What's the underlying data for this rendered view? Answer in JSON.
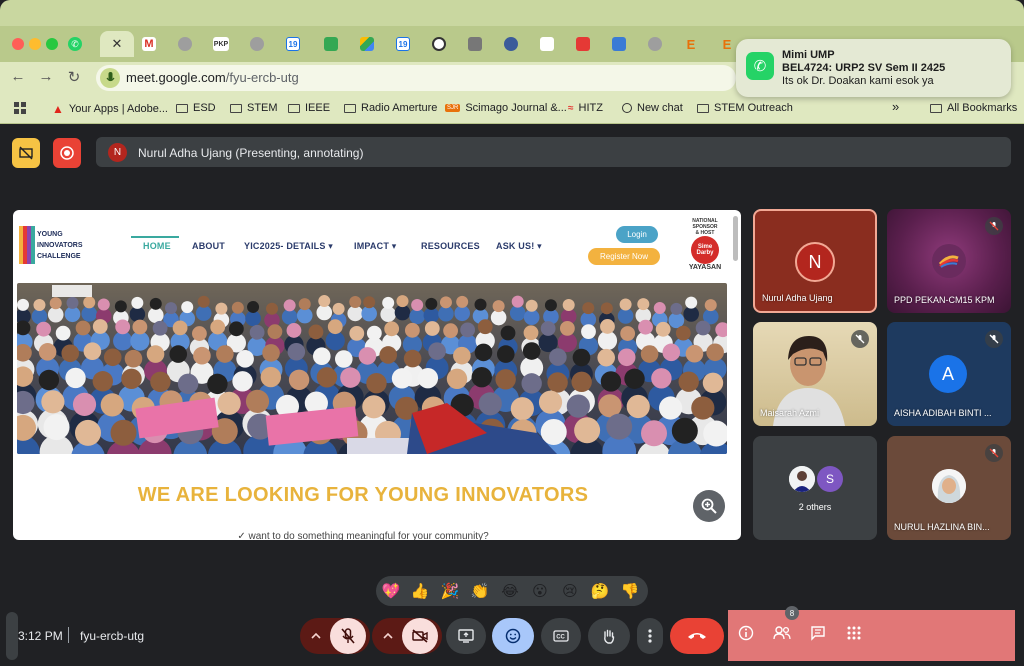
{
  "browser": {
    "url_host": "meet.google.com",
    "url_path": "/fyu-ercb-utg",
    "bookmarks": [
      "Your Apps | Adobe...",
      "ESD",
      "STEM",
      "IEEE",
      "Radio Amerture",
      "Scimago Journal &...",
      "HITZ",
      "New chat",
      "STEM Outreach"
    ],
    "bookmarks_overflow": "»",
    "all_bookmarks": "All Bookmarks",
    "scimago_badge": "SJR",
    "tab_pkp": "PKP",
    "tab_cal_a": "19",
    "tab_cal_b": "19",
    "tab_e_a": "E",
    "tab_e_b": "E"
  },
  "notification": {
    "sender": "Mimi UMP",
    "title": "BEL4724: URP2 SV Sem II 2425",
    "message": "Its ok Dr. Doakan kami esok ya"
  },
  "meet": {
    "presenting_initial": "N",
    "presenting_label": "Nurul Adha Ujang (Presenting, annotating)",
    "time": "3:12 PM",
    "meeting_code": "fyu-ercb-utg",
    "participant_count": "8"
  },
  "shared_page": {
    "logo_lines": [
      "YOUNG",
      "INNOVATORS",
      "CHALLENGE"
    ],
    "nav": [
      "HOME",
      "ABOUT",
      "YIC2025- DETAILS",
      "IMPACT",
      "RESOURCES",
      "ASK US!"
    ],
    "login": "Login",
    "register": "Register Now",
    "sponsor_lines": [
      "NATIONAL",
      "SPONSOR",
      "& HOST"
    ],
    "sponsor_logo": "Sime Darby",
    "sponsor_name": "YAYASAN",
    "headline": "WE ARE LOOKING FOR YOUNG INNOVATORS",
    "subline": "✓ want to do something meaningful for your community?"
  },
  "tiles": [
    {
      "name": "Nurul Adha Ujang",
      "initial": "N"
    },
    {
      "name": "PPD PEKAN-CM15 KPM"
    },
    {
      "name": "Maisarah Azmi"
    },
    {
      "name": "AISHA ADIBAH BINTI ...",
      "initial": "A"
    },
    {
      "name": "2 others",
      "initial": "S"
    },
    {
      "name": "NURUL HAZLINA BIN..."
    }
  ],
  "reactions": [
    "💖",
    "👍",
    "🎉",
    "👏",
    "😂",
    "😮",
    "😢",
    "🤔",
    "👎"
  ],
  "colors": {
    "chrome": "#c9d7a0",
    "meet_bg": "#202124",
    "leave_red": "#e94235",
    "side_panel": "#e17777",
    "headline_gold": "#e8b33c"
  }
}
